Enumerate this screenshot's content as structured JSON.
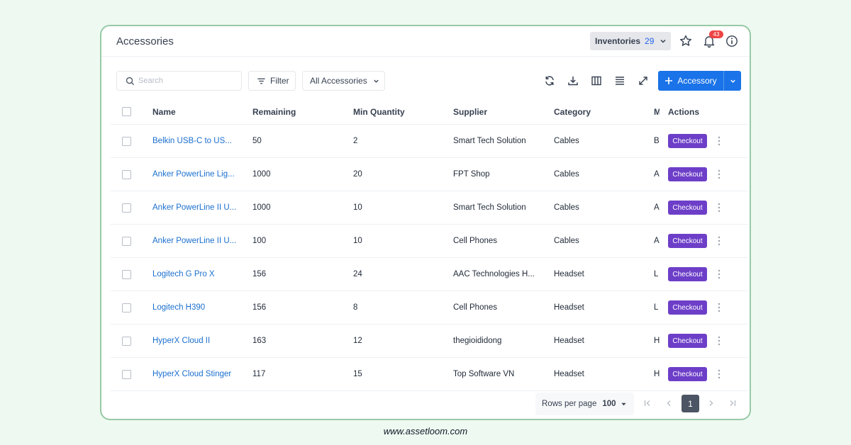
{
  "header": {
    "title": "Accessories",
    "inventories_label": "Inventories",
    "inventories_count": "29",
    "notification_count": "43"
  },
  "toolbar": {
    "search_placeholder": "Search",
    "filter_label": "Filter",
    "category_select": "All Accessories",
    "add_label": "Accessory"
  },
  "table": {
    "columns": [
      "Name",
      "Remaining",
      "Min Quantity",
      "Supplier",
      "Category",
      "M",
      "Actions"
    ],
    "rows": [
      {
        "name": "Belkin USB-C to US...",
        "remaining": "50",
        "min_qty": "2",
        "supplier": "Smart Tech Solution",
        "category": "Cables",
        "m": "B",
        "action": "Checkout"
      },
      {
        "name": "Anker PowerLine Lig...",
        "remaining": "1000",
        "min_qty": "20",
        "supplier": "FPT Shop",
        "category": "Cables",
        "m": "A",
        "action": "Checkout"
      },
      {
        "name": "Anker PowerLine II U...",
        "remaining": "1000",
        "min_qty": "10",
        "supplier": "Smart Tech Solution",
        "category": "Cables",
        "m": "A",
        "action": "Checkout"
      },
      {
        "name": "Anker PowerLine II U...",
        "remaining": "100",
        "min_qty": "10",
        "supplier": "Cell Phones",
        "category": "Cables",
        "m": "A",
        "action": "Checkout"
      },
      {
        "name": "Logitech G Pro X",
        "remaining": "156",
        "min_qty": "24",
        "supplier": "AAC Technologies H...",
        "category": "Headset",
        "m": "L",
        "action": "Checkout"
      },
      {
        "name": "Logitech H390",
        "remaining": "156",
        "min_qty": "8",
        "supplier": "Cell Phones",
        "category": "Headset",
        "m": "L",
        "action": "Checkout"
      },
      {
        "name": "HyperX Cloud II",
        "remaining": "163",
        "min_qty": "12",
        "supplier": "thegioididong",
        "category": "Headset",
        "m": "H",
        "action": "Checkout"
      },
      {
        "name": "HyperX Cloud Stinger",
        "remaining": "117",
        "min_qty": "15",
        "supplier": "Top Software VN",
        "category": "Headset",
        "m": "H",
        "action": "Checkout"
      }
    ]
  },
  "pagination": {
    "rows_per_page_label": "Rows per page",
    "rows_per_page_value": "100",
    "current_page": "1"
  },
  "footer_url": "www.assetloom.com",
  "colors": {
    "background": "#eefaf1",
    "card_border": "#98c9a6",
    "primary": "#1a73e8",
    "checkout": "#6d3fc8",
    "link": "#1a6fcf",
    "badge": "#ef4444"
  },
  "icons": [
    "search-icon",
    "filter-icon",
    "chevron-down-icon",
    "refresh-icon",
    "download-icon",
    "columns-icon",
    "density-icon",
    "fullscreen-icon",
    "plus-icon",
    "star-icon",
    "bell-icon",
    "info-icon",
    "kebab-icon",
    "first-page-icon",
    "prev-page-icon",
    "next-page-icon",
    "last-page-icon"
  ]
}
